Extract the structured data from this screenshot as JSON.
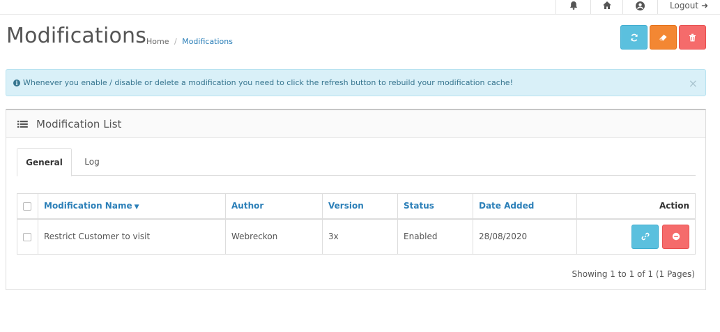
{
  "header": {
    "logout_label": "Logout",
    "icons": [
      "bell-icon",
      "home-icon",
      "user-icon",
      "sign-out-icon"
    ]
  },
  "page": {
    "title": "Modifications",
    "breadcrumb": {
      "home": "Home",
      "separator": "/",
      "current": "Modifications"
    },
    "buttons": [
      "refresh-button",
      "clear-button",
      "delete-button"
    ]
  },
  "alert": {
    "message": "Whenever you enable / disable or delete a modification you need to click the refresh button to rebuild your modification cache!",
    "close": "×"
  },
  "panel": {
    "title": "Modification List",
    "tabs": [
      {
        "label": "General",
        "active": true
      },
      {
        "label": "Log",
        "active": false
      }
    ]
  },
  "table": {
    "columns": [
      "Modification Name",
      "Author",
      "Version",
      "Status",
      "Date Added",
      "Action"
    ],
    "rows": [
      {
        "name": "Restrict Customer to visit",
        "author": "Webreckon",
        "version": "3x",
        "status": "Enabled",
        "date_added": "28/08/2020"
      }
    ]
  },
  "pagination": {
    "text": "Showing 1 to 1 of 1 (1 Pages)"
  },
  "colors": {
    "info": "#5bc0de",
    "warning": "#f38733",
    "danger": "#f56b6b",
    "link": "#2b7fb8",
    "alert_bg": "#d9f0f8"
  }
}
